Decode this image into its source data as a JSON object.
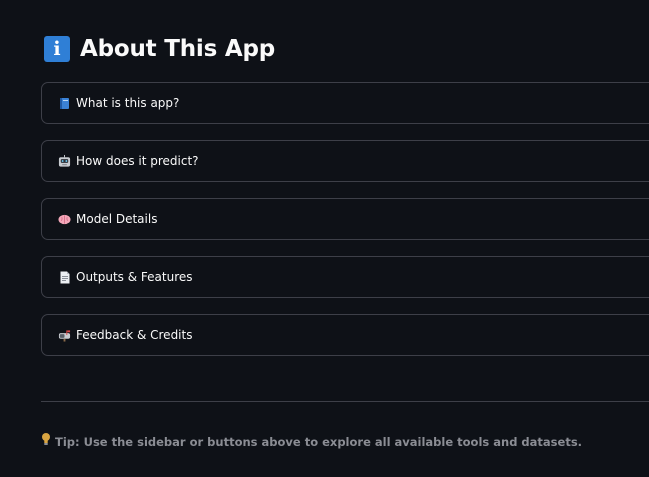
{
  "header": {
    "icon": "information-icon",
    "title": "About This App"
  },
  "expanders": [
    {
      "icon": "blue-book-icon",
      "label": "What is this app?"
    },
    {
      "icon": "robot-face-icon",
      "label": "How does it predict?"
    },
    {
      "icon": "brain-icon",
      "label": "Model Details"
    },
    {
      "icon": "document-icon",
      "label": "Outputs & Features"
    },
    {
      "icon": "mailbox-icon",
      "label": "Feedback & Credits"
    }
  ],
  "footer": {
    "tip_icon": "light-bulb-icon",
    "tip_text": "Tip: Use the sidebar or buttons above to explore all available tools and datasets."
  },
  "colors": {
    "background": "#0e1117",
    "border": "#3d3f48",
    "text": "#fafafa",
    "muted_text": "#8b8d94",
    "info_icon_bg": "#2f7fd6"
  }
}
